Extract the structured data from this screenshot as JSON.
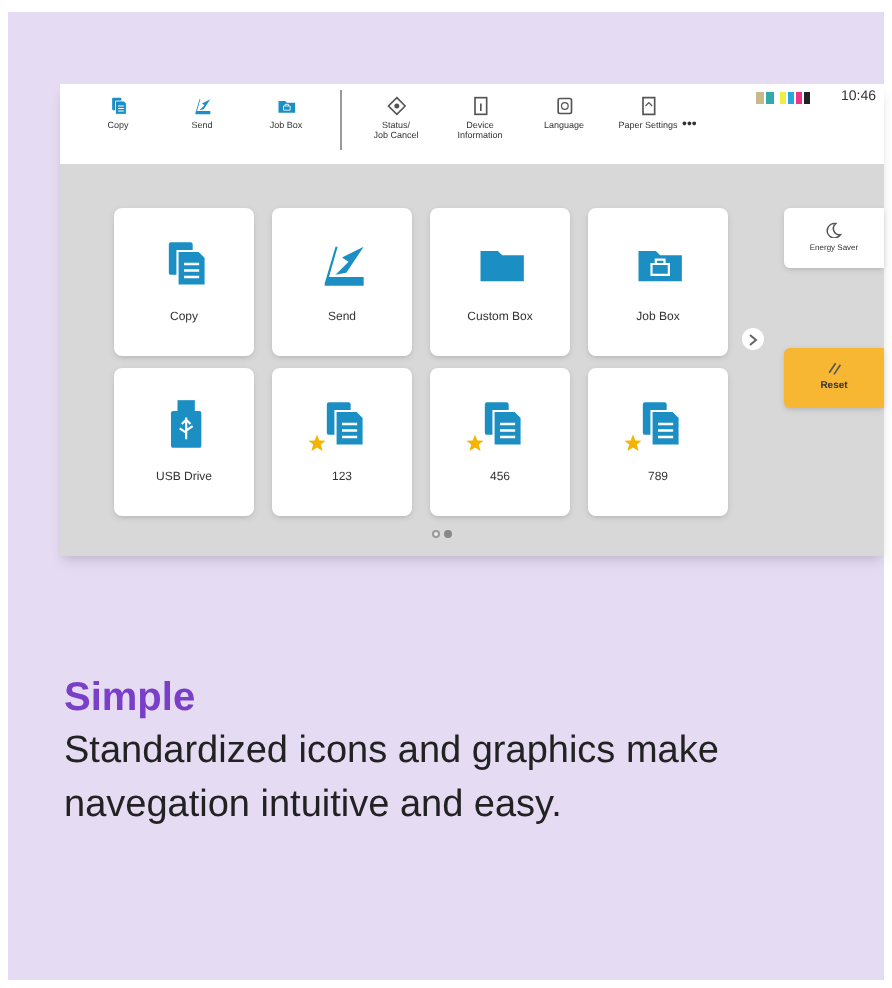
{
  "screen": {
    "toolbar": [
      {
        "label": "Copy",
        "kind": "copy"
      },
      {
        "label": "Send",
        "kind": "send"
      },
      {
        "label": "Job Box",
        "kind": "jobbox"
      },
      {
        "label": "Status/\nJob Cancel",
        "kind": "status"
      },
      {
        "label": "Device\nInformation",
        "kind": "device"
      },
      {
        "label": "Language",
        "kind": "language"
      },
      {
        "label": "Paper Settings",
        "kind": "paper"
      }
    ],
    "more": "•••",
    "time": "10:46",
    "tiles": [
      {
        "label": "Copy",
        "kind": "copy",
        "favorite": false
      },
      {
        "label": "Send",
        "kind": "send",
        "favorite": false
      },
      {
        "label": "Custom Box",
        "kind": "folder",
        "favorite": false
      },
      {
        "label": "Job Box",
        "kind": "jobbox",
        "favorite": false
      },
      {
        "label": "USB Drive",
        "kind": "usb",
        "favorite": false
      },
      {
        "label": "123",
        "kind": "copy",
        "favorite": true
      },
      {
        "label": "456",
        "kind": "copy",
        "favorite": true
      },
      {
        "label": "789",
        "kind": "copy",
        "favorite": true
      }
    ],
    "pages": [
      {
        "selected": false
      },
      {
        "selected": true
      }
    ],
    "energy_saver": "Energy Saver",
    "reset": "Reset"
  },
  "heading": "Simple",
  "description": "Standardized icons and graphics make navegation intuitive and easy."
}
